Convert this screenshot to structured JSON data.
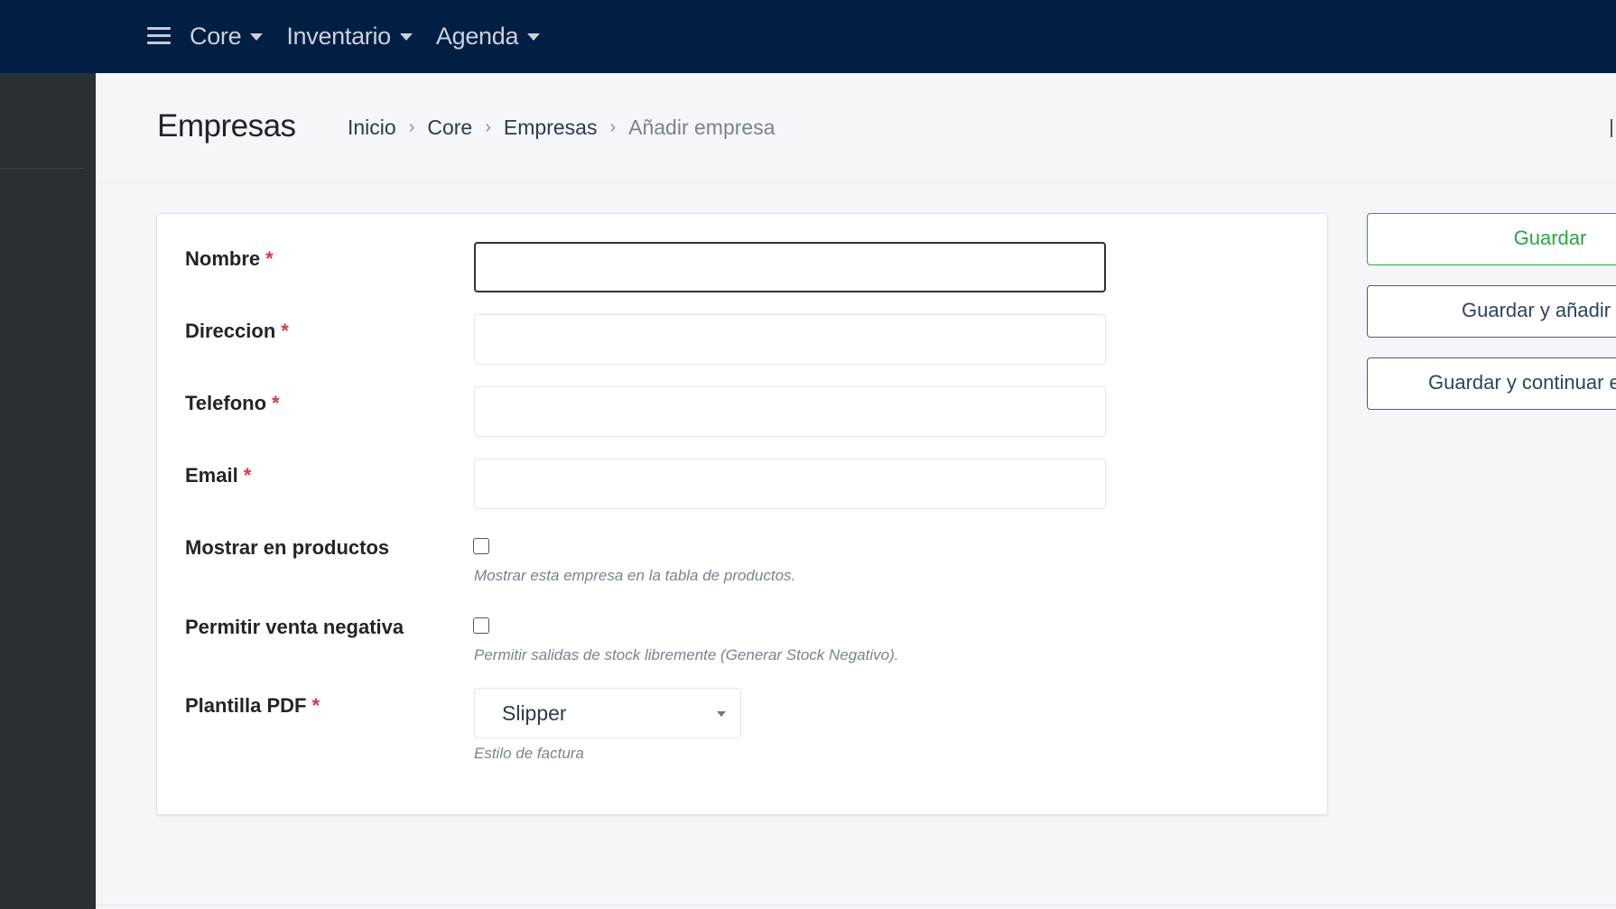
{
  "navbar": {
    "menu_icon": "hamburger-icon",
    "items": [
      {
        "label": "Core"
      },
      {
        "label": "Inventario"
      },
      {
        "label": "Agenda"
      }
    ]
  },
  "header": {
    "title": "Empresas",
    "breadcrumb": [
      "Inicio",
      "Core",
      "Empresas",
      "Añadir empresa"
    ],
    "separator": "›"
  },
  "form": {
    "required_mark": "*",
    "fields": {
      "nombre": {
        "label": "Nombre",
        "value": ""
      },
      "direccion": {
        "label": "Direccion",
        "value": ""
      },
      "telefono": {
        "label": "Telefono",
        "value": ""
      },
      "email": {
        "label": "Email",
        "value": ""
      },
      "mostrar": {
        "label": "Mostrar en productos",
        "checked": false,
        "help": "Mostrar esta empresa en la tabla de productos."
      },
      "venta_negativa": {
        "label": "Permitir venta negativa",
        "checked": false,
        "help": "Permitir salidas de stock libremente (Generar Stock Negativo)."
      },
      "plantilla": {
        "label": "Plantilla PDF",
        "value": "Slipper",
        "help": "Estilo de factura"
      }
    }
  },
  "actions": {
    "save": "Guardar",
    "save_add": "Guardar y añadir otro",
    "save_continue": "Guardar y continuar editando"
  },
  "colors": {
    "navbar": "#011e43",
    "sidebar": "#2a2f33",
    "save_accent": "#28a745",
    "required": "#dc3545"
  }
}
